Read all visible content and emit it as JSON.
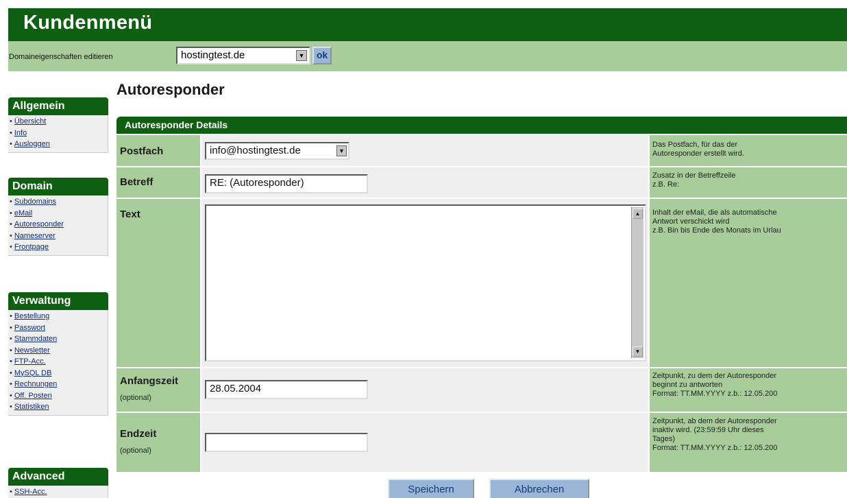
{
  "header": {
    "title": "Kundenmenü"
  },
  "domain_bar": {
    "label": "Domaineigenschaften editieren",
    "selected_domain": "hostingtest.de",
    "ok_label": "ok"
  },
  "sidebar": [
    {
      "title": "Allgemein",
      "items": [
        "Übersicht",
        "Info",
        "Ausloggen"
      ]
    },
    {
      "title": "Domain",
      "items": [
        "Subdomains",
        "eMail",
        "Autoresponder",
        "Nameserver",
        "Frontpage"
      ]
    },
    {
      "title": "Verwaltung",
      "items": [
        "Bestellung",
        "Passwort",
        "Stammdaten",
        "Newsletter",
        "FTP-Acc.",
        "MySQL DB",
        "Rechnungen",
        "Off. Posten",
        "Statistiken"
      ]
    },
    {
      "title": "Advanced",
      "items": [
        "SSH-Acc."
      ]
    }
  ],
  "page": {
    "title": "Autoresponder"
  },
  "panel": {
    "title": "Autoresponder Details",
    "postfach": {
      "label": "Postfach",
      "value": "info@hostingtest.de",
      "desc": "Das Postfach, für das der\nAutoresponder erstellt wird."
    },
    "betreff": {
      "label": "Betreff",
      "value": "RE: (Autoresponder)",
      "desc": "Zusatz in der Betreffzeile\nz.B. Re:"
    },
    "text": {
      "label": "Text",
      "value": "",
      "desc": "Inhalt der eMail, die als automatische\nAntwort verschickt wird\nz.B. Bin bis Ende des Monats im Urlau"
    },
    "anfangszeit": {
      "label": "Anfangszeit",
      "optional": "(optional)",
      "value": "28.05.2004",
      "desc": "Zeitpunkt, zu dem der Autoresponder\nbeginnt zu antworten\nFormat: TT.MM.YYYY z.b.: 12.05.200"
    },
    "endzeit": {
      "label": "Endzeit",
      "optional": "(optional)",
      "value": "",
      "desc": "Zeitpunkt, ab dem der Autoresponder\ninaktiv wird. (23:59:59 Uhr dieses\nTages)\nFormat: TT.MM.YYYY z.b.: 12.05.200"
    }
  },
  "buttons": {
    "save": "Speichern",
    "cancel": "Abbrechen"
  }
}
